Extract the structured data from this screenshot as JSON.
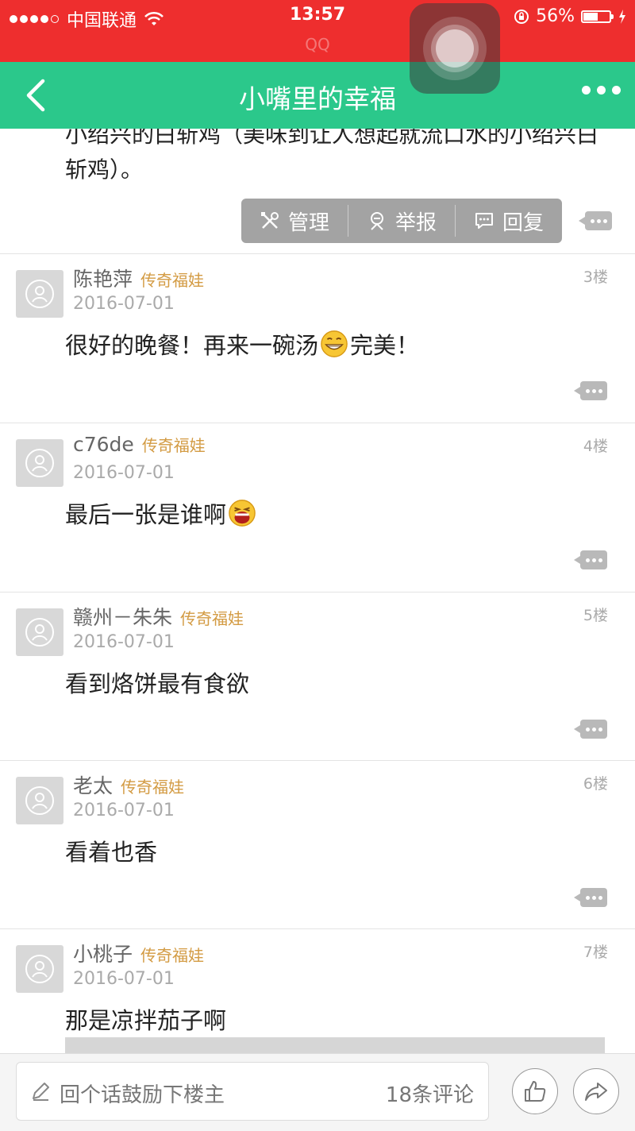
{
  "status_bar": {
    "carrier": "中国联通",
    "time": "13:57",
    "app_hint": "QQ",
    "battery": "56%",
    "battery_level": 0.56
  },
  "nav": {
    "title": "小嘴里的幸福"
  },
  "partial_post": {
    "text": "小绍兴的白斩鸡（美味到让人想起就流口水的小绍兴白斩鸡）。",
    "actions": [
      {
        "label": "管理",
        "icon": "tools-icon"
      },
      {
        "label": "举报",
        "icon": "report-icon"
      },
      {
        "label": "回复",
        "icon": "reply-icon"
      }
    ]
  },
  "posts": [
    {
      "name": "陈艳萍",
      "badge": "传奇福娃",
      "date": "2016-07-01",
      "floor": "3楼",
      "text_before": "很好的晚餐！再来一碗汤",
      "emoji": "grin-emoji",
      "text_after": "完美！"
    },
    {
      "name": "c76de",
      "badge": "传奇福娃",
      "date": "2016-07-01",
      "floor": "4楼",
      "text_before": "最后一张是谁啊",
      "emoji": "laugh-emoji",
      "text_after": ""
    },
    {
      "name": "赣州－朱朱",
      "badge": "传奇福娃",
      "date": "2016-07-01",
      "floor": "5楼",
      "text_before": "看到烙饼最有食欲",
      "emoji": "",
      "text_after": ""
    },
    {
      "name": "老太",
      "badge": "传奇福娃",
      "date": "2016-07-01",
      "floor": "6楼",
      "text_before": "看着也香",
      "emoji": "",
      "text_after": ""
    },
    {
      "name": "小桃子",
      "badge": "传奇福娃",
      "date": "2016-07-01",
      "floor": "7楼",
      "text_before": "那是凉拌茄子啊",
      "emoji": "",
      "text_after": ""
    }
  ],
  "bottom_bar": {
    "placeholder": "回个话鼓励下楼主",
    "comment_count": "18条评论"
  },
  "colors": {
    "status_bar": "#ee2e2e",
    "nav_bar": "#2bc88b",
    "badge": "#d39b43"
  }
}
